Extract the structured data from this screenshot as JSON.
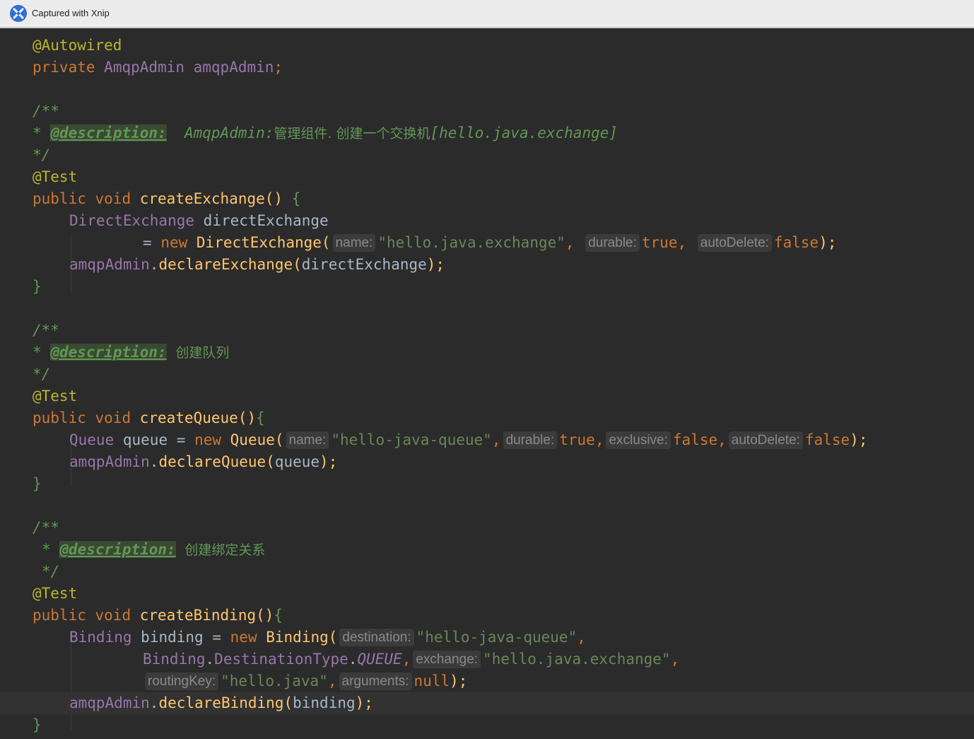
{
  "titlebar": {
    "title": "Captured with Xnip",
    "icon": "xnip-logo-icon"
  },
  "code": {
    "l1": "@Autowired",
    "l2": {
      "kw": "private",
      "type": "AmqpAdmin",
      "field": "amqpAdmin",
      "semi": ";"
    },
    "c1": {
      "open": "/**",
      "star": "*",
      "tag": "@description:",
      "text1": "AmqpAdmin:",
      "text2": "管理组件. 创建一个交换机",
      "text3": "[hello.java.exchange]",
      "close": "*/"
    },
    "t1": "@Test",
    "m1": {
      "kw1": "public",
      "kw2": "void",
      "name": "createExchange",
      "paren": "()",
      "brace": "{"
    },
    "m1b1": {
      "type": "DirectExchange",
      "var": "directExchange"
    },
    "m1b2": {
      "eq": "=",
      "kw": "new",
      "ctor": "DirectExchange",
      "paren": "(",
      "h1": "name:",
      "s1": "\"hello.java.exchange\"",
      "comma1": ",",
      "h2": "durable:",
      "v2": "true",
      "comma2": ",",
      "h3": "autoDelete:",
      "v3": "false",
      "end": ");"
    },
    "m1b3": {
      "obj": "amqpAdmin",
      "dot": ".",
      "fn": "declareExchange",
      "open": "(",
      "arg": "directExchange",
      "end": ");"
    },
    "close": "}",
    "c2": {
      "open": "/**",
      "star": "*",
      "tag": "@description:",
      "text": "创建队列",
      "close": "*/"
    },
    "t2": "@Test",
    "m2": {
      "kw1": "public",
      "kw2": "void",
      "name": "createQueue",
      "paren": "()",
      "brace": "{"
    },
    "m2b1": {
      "type": "Queue",
      "var": "queue",
      "eq": "=",
      "kw": "new",
      "ctor": "Queue",
      "paren": "(",
      "h1": "name:",
      "s1": "\"hello-java-queue\"",
      "comma": ",",
      "h2": "durable:",
      "v2": "true",
      "h3": "exclusive:",
      "v3": "false",
      "h4": "autoDelete:",
      "v4": "false",
      "end": ");"
    },
    "m2b2": {
      "obj": "amqpAdmin",
      "dot": ".",
      "fn": "declareQueue",
      "open": "(",
      "arg": "queue",
      "end": ");"
    },
    "c3": {
      "open": "/**",
      "star": "*",
      "tag": "@description:",
      "text": "创建绑定关系",
      "close": "*/"
    },
    "t3": "@Test",
    "m3": {
      "kw1": "public",
      "kw2": "void",
      "name": "createBinding",
      "paren": "()",
      "brace": "{"
    },
    "m3b1": {
      "type": "Binding",
      "var": "binding",
      "eq": "=",
      "kw": "new",
      "ctor": "Binding",
      "paren": "(",
      "h1": "destination:",
      "s1": "\"hello-java-queue\"",
      "comma": ","
    },
    "m3b2": {
      "type": "Binding",
      "dot": ".",
      "inner": "DestinationType",
      "const": "QUEUE",
      "comma": ",",
      "h2": "exchange:",
      "s2": "\"hello.java.exchange\""
    },
    "m3b3": {
      "h3": "routingKey:",
      "s3": "\"hello.java\"",
      "comma": ",",
      "h4": "arguments:",
      "v4": "null",
      "end": ");"
    },
    "m3b4": {
      "obj": "amqpAdmin",
      "dot": ".",
      "fn": "declareBinding",
      "open": "(",
      "arg": "binding",
      "end": ");"
    }
  },
  "colors": {
    "background": "#2b2b2b",
    "keyword": "#cc7832",
    "annotation": "#bbb529",
    "string": "#6a8759",
    "function": "#ffc66d",
    "field": "#9876aa",
    "comment": "#629755"
  }
}
